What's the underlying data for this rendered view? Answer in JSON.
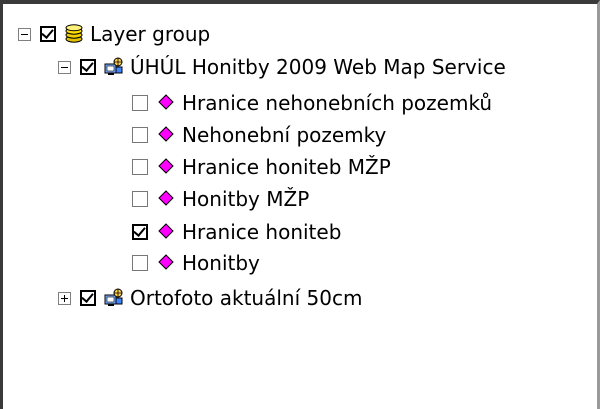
{
  "tree": {
    "items": [
      {
        "label": "Layer group",
        "icon": "layer-group-icon",
        "expander": "minus",
        "checked": true
      },
      {
        "label": "ÚHÚL Honitby 2009 Web Map Service",
        "icon": "wms-service-icon",
        "expander": "minus",
        "checked": true
      },
      {
        "label": "Hranice nehonebních pozemků",
        "icon": "layer-diamond-icon",
        "checked": false
      },
      {
        "label": "Nehonební pozemky",
        "icon": "layer-diamond-icon",
        "checked": false
      },
      {
        "label": "Hranice honiteb MŽP",
        "icon": "layer-diamond-icon",
        "checked": false
      },
      {
        "label": "Honitby MŽP",
        "icon": "layer-diamond-icon",
        "checked": false
      },
      {
        "label": "Hranice honiteb",
        "icon": "layer-diamond-icon",
        "checked": true
      },
      {
        "label": "Honitby",
        "icon": "layer-diamond-icon",
        "checked": false
      },
      {
        "label": "Ortofoto aktuální 50cm",
        "icon": "wms-service-icon",
        "expander": "plus",
        "checked": true
      }
    ]
  },
  "colors": {
    "layer_icon": "#ff00ff",
    "group_icon": "#e0c000"
  }
}
